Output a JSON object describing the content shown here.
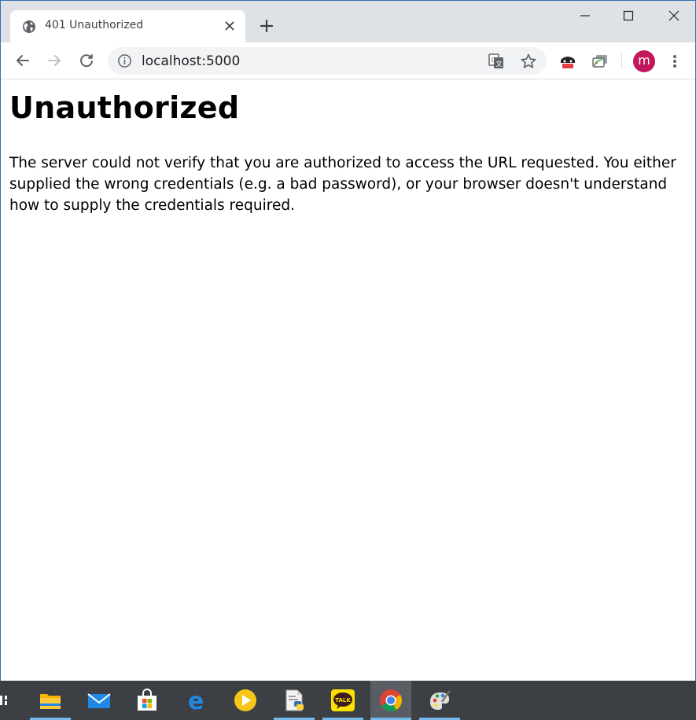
{
  "browser": {
    "tab": {
      "title": "401 Unauthorized",
      "favicon": "globe-icon"
    },
    "new_tab_icon": "plus-icon",
    "window_controls": [
      "minimize-icon",
      "maximize-icon",
      "close-icon"
    ],
    "toolbar": {
      "back_icon": "arrow-left-icon",
      "forward_icon": "arrow-right-icon",
      "reload_icon": "reload-icon",
      "address": {
        "info_icon": "info-icon",
        "url": "localhost:5000",
        "translate_icon": "translate-icon",
        "bookmark_icon": "star-icon"
      },
      "extensions": [
        "incognito-extension-icon",
        "cast-extension-icon"
      ],
      "profile_initial": "m",
      "profile_color": "#c2185b",
      "menu_icon": "more-vertical-icon"
    }
  },
  "page": {
    "heading": "Unauthorized",
    "message": "The server could not verify that you are authorized to access the URL requested. You either supplied the wrong credentials (e.g. a bad password), or your browser doesn't understand how to supply the credentials required."
  },
  "taskbar": {
    "items": [
      {
        "name": "file-explorer-icon",
        "open": true,
        "active": false
      },
      {
        "name": "mail-icon",
        "open": false,
        "active": false
      },
      {
        "name": "microsoft-store-icon",
        "open": false,
        "active": false
      },
      {
        "name": "edge-icon",
        "open": false,
        "active": false
      },
      {
        "name": "media-player-icon",
        "open": false,
        "active": false
      },
      {
        "name": "python-editor-icon",
        "open": true,
        "active": false
      },
      {
        "name": "kakaotalk-icon",
        "label": "TALK",
        "open": true,
        "active": false
      },
      {
        "name": "chrome-icon",
        "open": true,
        "active": true
      },
      {
        "name": "paint-icon",
        "open": true,
        "active": false
      }
    ]
  },
  "colors": {
    "tabstrip": "#dee1e6",
    "omnibox": "#f1f3f4",
    "taskbar": "#3c3f44",
    "taskbar_indicator": "#76b9ed",
    "heading_text": "#000000"
  }
}
